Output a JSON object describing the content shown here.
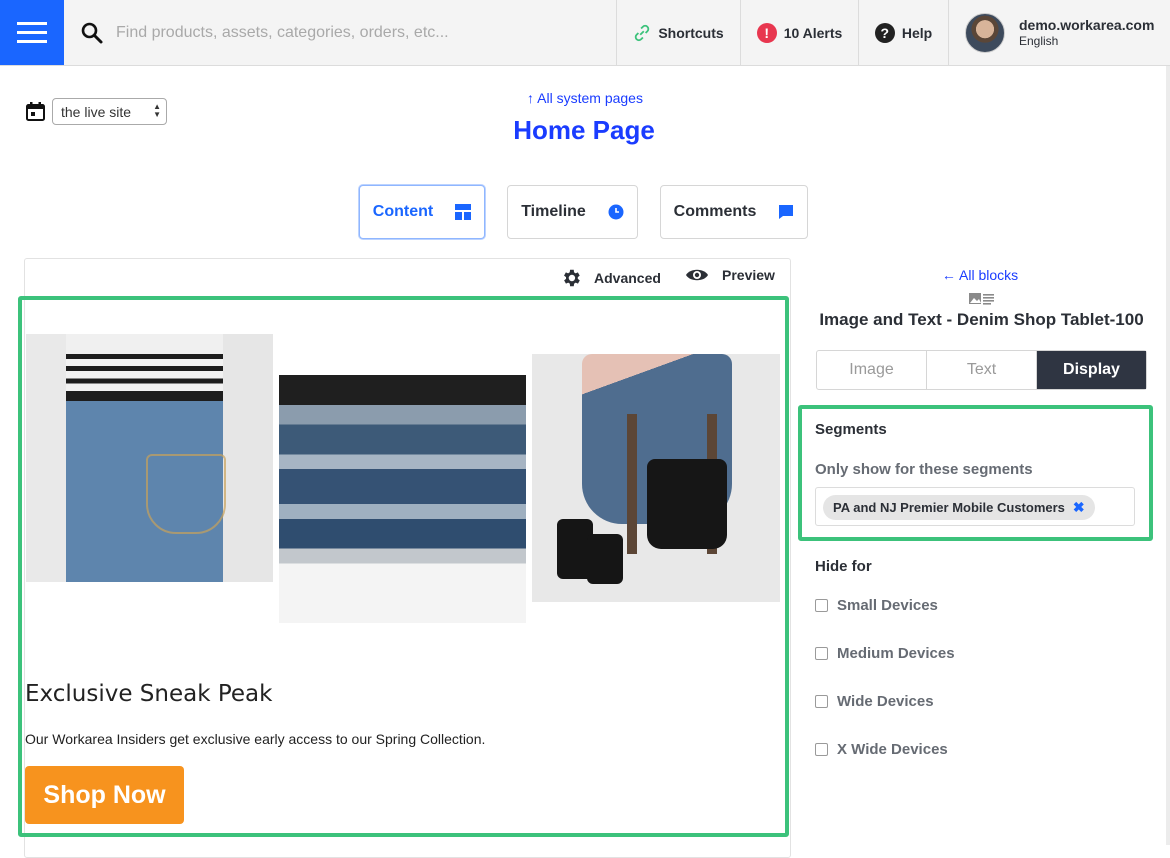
{
  "topbar": {
    "search_placeholder": "Find products, assets, categories, orders, etc...",
    "shortcuts_label": "Shortcuts",
    "alerts_label": "10 Alerts",
    "alert_icon_glyph": "!",
    "help_label": "Help",
    "help_icon_glyph": "?",
    "user_domain": "demo.workarea.com",
    "user_language": "English",
    "brand_color": "#1a66ff"
  },
  "page": {
    "site_select_value": "the live site",
    "system_pages_link": "↑ All system pages",
    "title": "Home Page"
  },
  "tabs": [
    {
      "label": "Content",
      "icon": "layout-icon",
      "active": true
    },
    {
      "label": "Timeline",
      "icon": "clock-icon",
      "active": false
    },
    {
      "label": "Comments",
      "icon": "comment-icon",
      "active": false
    }
  ],
  "preview": {
    "advanced_label": "Advanced",
    "preview_label": "Preview",
    "hero_title": "Exclusive Sneak Peak",
    "hero_text": "Our Workarea Insiders get exclusive early access to our Spring Collection.",
    "cta_label": "Shop Now",
    "cta_color": "#f7931e",
    "highlight_color": "#3cc27b"
  },
  "sidebar": {
    "back_link": "← All blocks",
    "block_title": "Image and Text - Denim Shop Tablet-100",
    "sub_tabs": [
      {
        "label": "Image",
        "active": false
      },
      {
        "label": "Text",
        "active": false
      },
      {
        "label": "Display",
        "active": true
      }
    ],
    "segments_heading": "Segments",
    "segments_label": "Only show for these segments",
    "segment_chip": "PA and NJ Premier Mobile Customers",
    "segment_chip_remove": "✖",
    "hide_heading": "Hide for",
    "hide_options": [
      {
        "label": "Small Devices",
        "checked": false
      },
      {
        "label": "Medium Devices",
        "checked": false
      },
      {
        "label": "Wide Devices",
        "checked": false
      },
      {
        "label": "X Wide Devices",
        "checked": false
      }
    ]
  }
}
